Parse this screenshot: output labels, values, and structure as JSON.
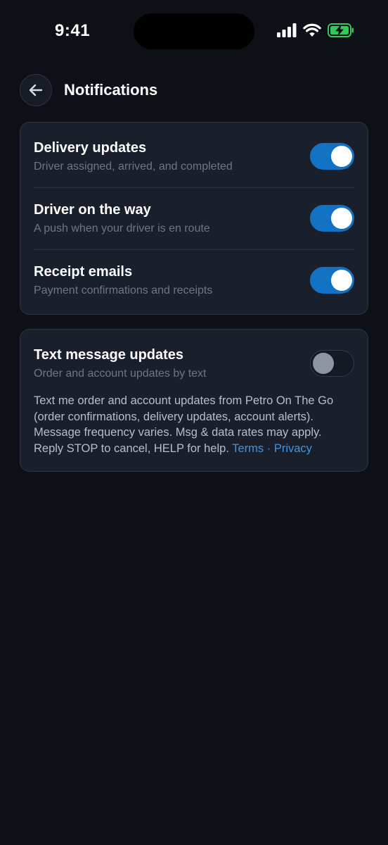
{
  "status_bar": {
    "time": "9:41"
  },
  "header": {
    "title": "Notifications"
  },
  "preferences": [
    {
      "title": "Delivery updates",
      "subtitle": "Driver assigned, arrived, and completed",
      "enabled": true
    },
    {
      "title": "Driver on the way",
      "subtitle": "A push when your driver is en route",
      "enabled": true
    },
    {
      "title": "Receipt emails",
      "subtitle": "Payment confirmations and receipts",
      "enabled": true
    }
  ],
  "sms": {
    "title": "Text message updates",
    "subtitle": "Order and account updates by text",
    "enabled": false,
    "description": "Text me order and account updates from Petro On The Go (order confirmations, delivery updates, account alerts). Message frequency varies. Msg & data rates may apply. Reply STOP to cancel, HELP for help.",
    "terms_label": "Terms",
    "separator": "·",
    "privacy_label": "Privacy"
  },
  "colors": {
    "background": "#0d1016",
    "card": "#1a1f2c",
    "toggle_on": "#1273c4",
    "link": "#3d96e2",
    "battery": "#34c759"
  }
}
